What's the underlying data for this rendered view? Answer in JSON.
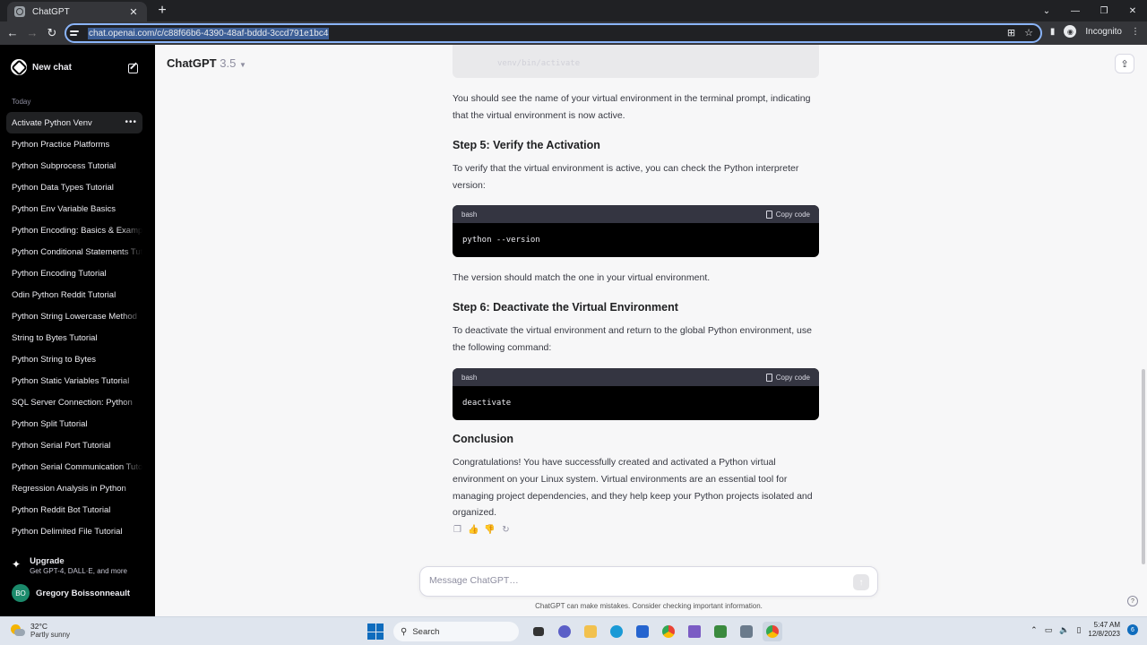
{
  "browser": {
    "tab_title": "ChatGPT",
    "url": "chat.openai.com/c/c88f66b6-4390-48af-bddd-3ccd791e1bc4",
    "profile_label": "Incognito"
  },
  "sidebar": {
    "new_chat": "New chat",
    "section_label": "Today",
    "items": [
      {
        "label": "Activate Python Venv",
        "active": true
      },
      {
        "label": "Python Practice Platforms"
      },
      {
        "label": "Python Subprocess Tutorial"
      },
      {
        "label": "Python Data Types Tutorial"
      },
      {
        "label": "Python Env Variable Basics"
      },
      {
        "label": "Python Encoding: Basics & Examples"
      },
      {
        "label": "Python Conditional Statements Tutorial"
      },
      {
        "label": "Python Encoding Tutorial"
      },
      {
        "label": "Odin Python Reddit Tutorial"
      },
      {
        "label": "Python String Lowercase Method"
      },
      {
        "label": "String to Bytes Tutorial"
      },
      {
        "label": "Python String to Bytes"
      },
      {
        "label": "Python Static Variables Tutorial"
      },
      {
        "label": "SQL Server Connection: Python"
      },
      {
        "label": "Python Split Tutorial"
      },
      {
        "label": "Python Serial Port Tutorial"
      },
      {
        "label": "Python Serial Communication Tutorial"
      },
      {
        "label": "Regression Analysis in Python"
      },
      {
        "label": "Python Reddit Bot Tutorial"
      },
      {
        "label": "Python Delimited File Tutorial"
      }
    ],
    "upgrade_title": "Upgrade",
    "upgrade_sub": "Get GPT-4, DALL·E, and more",
    "user_initials": "BO",
    "user_name": "Gregory Boissonneault"
  },
  "header": {
    "model": "ChatGPT",
    "version": "3.5"
  },
  "conversation": {
    "code_tail": "venv/bin/activate",
    "p1": "You should see the name of your virtual environment in the terminal prompt, indicating that the virtual environment is now active.",
    "step5_heading": "Step 5: Verify the Activation",
    "p2": "To verify that the virtual environment is active, you can check the Python interpreter version:",
    "code1_lang": "bash",
    "code1_copy": "Copy code",
    "code1": "python --version",
    "p3": "The version should match the one in your virtual environment.",
    "step6_heading": "Step 6: Deactivate the Virtual Environment",
    "p4": "To deactivate the virtual environment and return to the global Python environment, use the following command:",
    "code2_lang": "bash",
    "code2_copy": "Copy code",
    "code2": "deactivate",
    "conclusion_heading": "Conclusion",
    "p5": "Congratulations! You have successfully created and activated a Python virtual environment on your Linux system. Virtual environments are an essential tool for managing project dependencies, and they help keep your Python projects isolated and organized."
  },
  "composer": {
    "placeholder": "Message ChatGPT…",
    "disclaimer": "ChatGPT can make mistakes. Consider checking important information."
  },
  "taskbar": {
    "temp": "32°C",
    "condition": "Partly sunny",
    "search": "Search",
    "time": "5:47 AM",
    "date": "12/8/2023",
    "notifications": "6"
  },
  "colors": {
    "sidebar_bg": "#000000",
    "main_bg": "#f7f7f8",
    "code_bg": "#000000",
    "code_header": "#343541",
    "avatar": "#1b8a6b"
  }
}
